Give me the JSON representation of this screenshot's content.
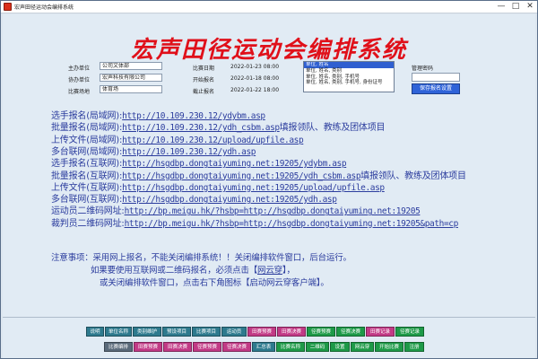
{
  "window": {
    "title": "宏声田径运动会编排系统",
    "buttons": {
      "minimize": "—",
      "maximize": "□",
      "close": "✕"
    }
  },
  "app_title": "宏声田径运动会编排系统",
  "info": {
    "organizer_label": "主办单位",
    "organizer_value": "公司文体部",
    "co_organizer_label": "协办单位",
    "co_organizer_value": "宏声科技有限公司",
    "venue_label": "比赛场地",
    "venue_value": "体育场",
    "match_date_label": "比赛日期",
    "match_date_value": "2022-01-23 08:00",
    "signup_start_label": "开始报名",
    "signup_start_value": "2022-01-18 08:00",
    "signup_end_label": "截止报名",
    "signup_end_value": "2022-01-22 18:00"
  },
  "report_options": [
    {
      "label": "单位, 姓名",
      "selected": true
    },
    {
      "label": "单位, 姓名, 类别",
      "selected": false
    },
    {
      "label": "单位, 姓名, 类别, 手机号",
      "selected": false
    },
    {
      "label": "单位, 姓名, 类别, 手机号, 身份证号",
      "selected": false
    }
  ],
  "admin": {
    "password_label": "管理密码",
    "save_button": "保存报名设置"
  },
  "links": [
    {
      "label": "选手报名(局域网):",
      "url": "http://10.109.230.12/ydybm.asp",
      "suffix": ""
    },
    {
      "label": "批量报名(局域网):",
      "url": "http://10.109.230.12/ydh_csbm.asp",
      "suffix": "填报领队、教练及团体项目"
    },
    {
      "label": "上传文件(局域网):",
      "url": "http://10.109.230.12/upload/upfile.asp",
      "suffix": ""
    },
    {
      "label": "多台联网(局域网):",
      "url": "http://10.109.230.12/ydh.asp",
      "suffix": ""
    },
    {
      "label": "选手报名(互联网):",
      "url": "http://hsgdbp.dongtaiyuming.net:19205/ydybm.asp",
      "suffix": ""
    },
    {
      "label": "批量报名(互联网):",
      "url": "http://hsgdbp.dongtaiyuming.net:19205/ydh_csbm.asp",
      "suffix": "填报领队、教练及团体项目"
    },
    {
      "label": "上传文件(互联网):",
      "url": "http://hsgdbp.dongtaiyuming.net:19205/upload/upfile.asp",
      "suffix": ""
    },
    {
      "label": "多台联网(互联网):",
      "url": "http://hsgdbp.dongtaiyuming.net:19205/ydh.asp",
      "suffix": ""
    },
    {
      "label": "运动员二维码网址:",
      "url": "http://bp.meigu.hk/?hsbp=http://hsgdbp.dongtaiyuming.net:19205",
      "suffix": ""
    },
    {
      "label": "裁判员二维码网址:",
      "url": "http://bp.meigu.hk/?hsbp=http://hsgdbp.dongtaiyuming.net:19205&path=cp",
      "suffix": ""
    }
  ],
  "notice": {
    "line1": "注意事项：采用网上报名，不能关闭编排系统！！关闭编排软件窗口，后台运行。",
    "line2_pre": "如果要使用互联网或二维码报名，必须点击【",
    "line2_link": "网云穿",
    "line2_post": "】，",
    "line3": "或关闭编排软件窗口，点击右下角图标【启动网云穿客户端】。"
  },
  "toolbar_row1": [
    {
      "label": "说明",
      "color": "#2e7a8e"
    },
    {
      "label": "单位名称",
      "color": "#2e7a8e"
    },
    {
      "label": "类别维护",
      "color": "#2e7a8e"
    },
    {
      "label": "预设项目",
      "color": "#2e7a8e"
    },
    {
      "label": "比赛项目",
      "color": "#2e7a8e"
    },
    {
      "label": "运动员",
      "color": "#2e7a8e"
    },
    {
      "label": "田赛预赛",
      "color": "#c23a86"
    },
    {
      "label": "田赛决赛",
      "color": "#c23a86"
    },
    {
      "label": "径赛预赛",
      "color": "#1e9a48"
    },
    {
      "label": "径赛决赛",
      "color": "#1e9a48"
    },
    {
      "label": "田赛记录",
      "color": "#c23a86"
    },
    {
      "label": "径赛记录",
      "color": "#1e9a48"
    }
  ],
  "toolbar_row2": [
    {
      "label": "比赛编排",
      "color": "#5a6a7a"
    },
    {
      "label": "田赛预赛",
      "color": "#c23a86"
    },
    {
      "label": "田赛决赛",
      "color": "#c23a86"
    },
    {
      "label": "径赛预赛",
      "color": "#c23a86"
    },
    {
      "label": "径赛决赛",
      "color": "#c23a86"
    },
    {
      "label": "汇总表",
      "color": "#2e7a8e"
    },
    {
      "label": "比赛名称",
      "color": "#1e9a48"
    },
    {
      "label": "二维码",
      "color": "#1e9a48"
    },
    {
      "label": "设置",
      "color": "#1e9a48"
    },
    {
      "label": "网云穿",
      "color": "#1e9a48"
    },
    {
      "label": "开始比赛",
      "color": "#1e9a48"
    },
    {
      "label": "注册",
      "color": "#1e9a48"
    }
  ]
}
